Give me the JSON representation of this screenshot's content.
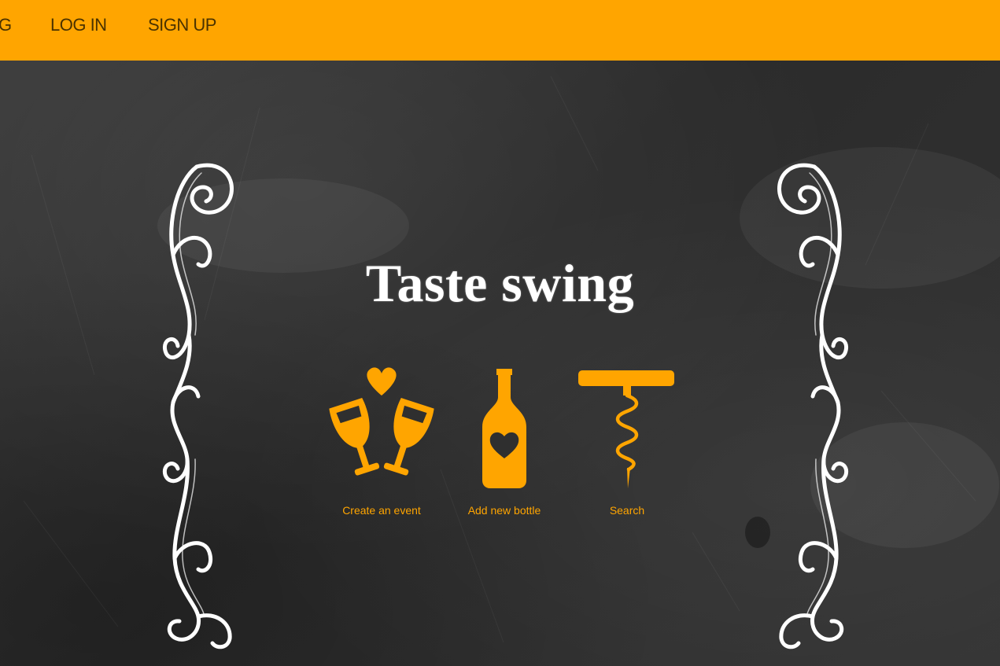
{
  "nav": {
    "partial_label": "G",
    "login_label": "LOG IN",
    "signup_label": "SIGN UP"
  },
  "hero": {
    "title": "Taste swing"
  },
  "actions": [
    {
      "label": "Create an event",
      "icon": "toasting-glasses-heart-icon"
    },
    {
      "label": "Add new bottle",
      "icon": "wine-bottle-heart-icon"
    },
    {
      "label": "Search",
      "icon": "corkscrew-icon"
    }
  ],
  "colors": {
    "accent": "#ffa500",
    "nav_text": "#4a3200",
    "chalkboard": "#2f2f2f",
    "chalk": "#ffffff"
  }
}
